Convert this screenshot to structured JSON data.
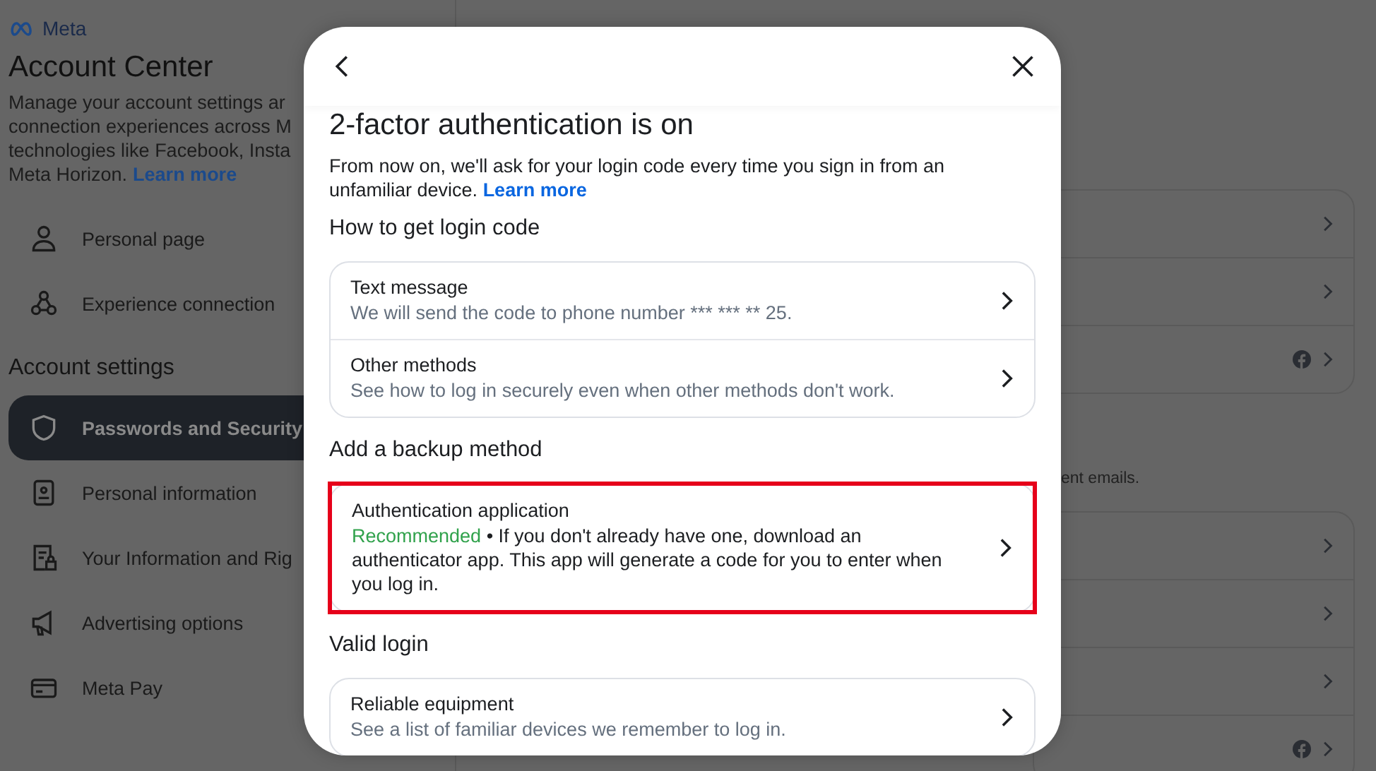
{
  "sidebar": {
    "logo": "Meta",
    "title": "Account Center",
    "description_lines": [
      "Manage your account settings ar",
      "connection experiences across M",
      "technologies like Facebook, Insta",
      "Meta Horizon."
    ],
    "learn_more": "Learn more",
    "top_items": [
      {
        "label": "Personal page"
      },
      {
        "label": "Experience connection"
      }
    ],
    "section_title": "Account settings",
    "settings_items": [
      {
        "label": "Passwords and Security",
        "selected": true
      },
      {
        "label": "Personal information",
        "selected": false
      },
      {
        "label": "Your Information and Rig",
        "selected": false
      },
      {
        "label": "Advertising options",
        "selected": false
      },
      {
        "label": "Meta Pay",
        "selected": false
      }
    ]
  },
  "main": {
    "cards": [
      {
        "rows": [
          {
            "kind": "plain"
          },
          {
            "kind": "plain"
          },
          {
            "kind": "facebook"
          }
        ]
      },
      {
        "note": "ent emails.",
        "rows": [
          {
            "kind": "plain"
          },
          {
            "kind": "plain"
          },
          {
            "kind": "plain"
          },
          {
            "kind": "facebook"
          }
        ]
      }
    ]
  },
  "dialog": {
    "title": "2-factor authentication is on",
    "description": "From now on, we'll ask for your login code every time you sign in from an unfamiliar device.",
    "learn_more": "Learn more",
    "sections": [
      {
        "heading": "How to get login code",
        "options": [
          {
            "title": "Text message",
            "subtitle": "We will send the code to phone number *** *** ** 25.",
            "highlighted": false
          },
          {
            "title": "Other methods",
            "subtitle": "See how to log in securely even when other methods don't work.",
            "highlighted": false
          }
        ]
      },
      {
        "heading": "Add a backup method",
        "options": [
          {
            "title": "Authentication application",
            "tag": "Recommended",
            "subtitle": "• If you don't already have one, download an authenticator app. This app will generate a code for you to enter when you log in.",
            "highlighted": true
          }
        ]
      },
      {
        "heading": "Valid login",
        "options": [
          {
            "title": "Reliable equipment",
            "subtitle": "See a list of familiar devices we remember to log in.",
            "highlighted": false
          }
        ]
      }
    ]
  }
}
